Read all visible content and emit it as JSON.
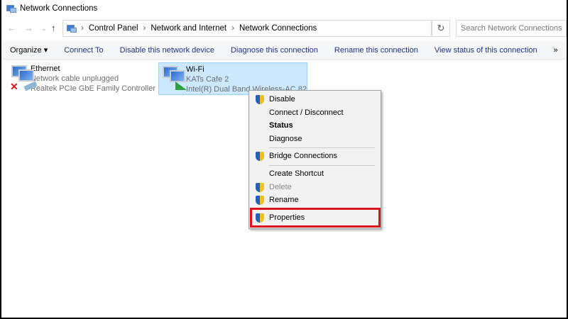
{
  "window": {
    "title": "Network Connections"
  },
  "address": {
    "crumbs": [
      "Control Panel",
      "Network and Internet",
      "Network Connections"
    ],
    "search_placeholder": "Search Network Connections"
  },
  "commands": [
    "Organize ▾",
    "Connect To",
    "Disable this network device",
    "Diagnose this connection",
    "Rename this connection",
    "View status of this connection",
    "»"
  ],
  "connections": [
    {
      "name": "Ethernet",
      "status": "Network cable unplugged",
      "device": "Realtek PCIe GbE Family Controller"
    },
    {
      "name": "Wi-Fi",
      "status": "KATs Cafe 2",
      "device": "Intel(R) Dual Band Wireless-AC 82"
    }
  ],
  "context_menu": {
    "items": [
      "Disable",
      "Connect / Disconnect",
      "Status",
      "Diagnose",
      "Bridge Connections",
      "Create Shortcut",
      "Delete",
      "Rename",
      "Properties"
    ]
  },
  "colors": {
    "highlight": "#d9151b",
    "selection": "#cce8ff"
  }
}
